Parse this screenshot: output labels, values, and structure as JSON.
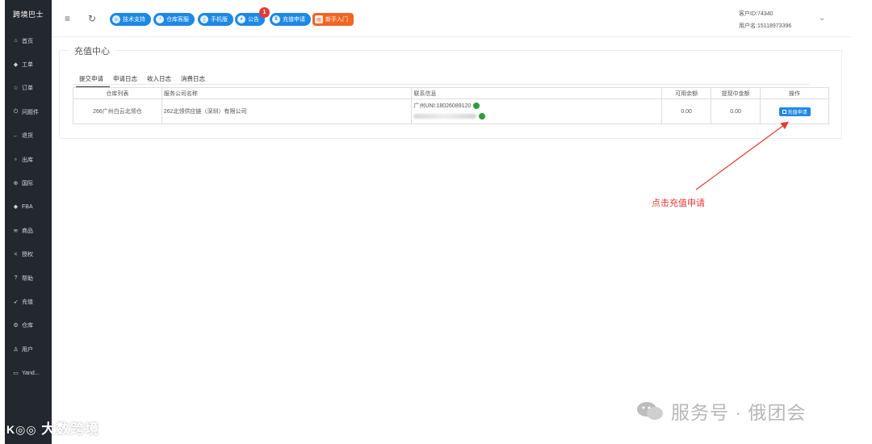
{
  "sidebar": {
    "brand": "跨境巴士",
    "items": [
      {
        "label": "首页",
        "icon": "home-icon",
        "glyph": "⌂"
      },
      {
        "label": "工单",
        "icon": "diamond-icon",
        "glyph": "◆"
      },
      {
        "label": "订单",
        "icon": "star-icon",
        "glyph": "☆"
      },
      {
        "label": "问题件",
        "icon": "power-icon",
        "glyph": "⏻"
      },
      {
        "label": "退货",
        "icon": "arrow-left-icon",
        "glyph": "←"
      },
      {
        "label": "出库",
        "icon": "thumb-icon",
        "glyph": "♁"
      },
      {
        "label": "国际",
        "icon": "globe-icon",
        "glyph": "⊕"
      },
      {
        "label": "FBA",
        "icon": "diamond-icon",
        "glyph": "◆"
      },
      {
        "label": "商品",
        "icon": "stack-icon",
        "glyph": "≋"
      },
      {
        "label": "授权",
        "icon": "share-icon",
        "glyph": "<"
      },
      {
        "label": "帮助",
        "icon": "question-icon",
        "glyph": "?"
      },
      {
        "label": "充值",
        "icon": "send-icon",
        "glyph": "➶"
      },
      {
        "label": "仓库",
        "icon": "gear-icon",
        "glyph": "⚙"
      },
      {
        "label": "用户",
        "icon": "users-icon",
        "glyph": "♙"
      },
      {
        "label": "Yand...",
        "icon": "card-icon",
        "glyph": "▭"
      }
    ]
  },
  "topbar": {
    "menu_icon": "menu-icon",
    "refresh_icon": "refresh-icon",
    "pills": [
      {
        "label": "技术支持",
        "icon": "headset-icon",
        "glyph": "☏"
      },
      {
        "label": "仓库客服",
        "icon": "headphones-icon",
        "glyph": "◔"
      },
      {
        "label": "手机版",
        "icon": "phone-icon",
        "glyph": "▯"
      },
      {
        "label": "公告",
        "icon": "megaphone-icon",
        "glyph": "◕"
      },
      {
        "label": "充值申请",
        "icon": "money-icon",
        "glyph": "¥"
      },
      {
        "label": "新手入门",
        "icon": "book-icon",
        "glyph": "▤"
      }
    ],
    "notice_badge": "1",
    "customer_id": "客户ID:74340",
    "username": "用户名:15118973396"
  },
  "panel": {
    "title": "充值中心",
    "tabs": [
      "提交申请",
      "申请日志",
      "收入日志",
      "消费日志"
    ],
    "columns": [
      "仓库列表",
      "服务公司名称",
      "联系信息",
      "可用余额",
      "提现中金额",
      "操作"
    ],
    "rows": [
      {
        "warehouse": "266广州白云北领仓",
        "company": "262北领供应链（深圳）有限公司",
        "contact": "广州UNI:18026089120",
        "available": "0.00",
        "withdrawing": "0.00",
        "action": "充值申请"
      }
    ]
  },
  "annotation": {
    "text": "点击充值申请",
    "color": "#e53935"
  },
  "watermarks": {
    "left": "大数跨境",
    "right": "服务号 · 俄团会"
  },
  "colors": {
    "sidebar_bg": "#23272e",
    "accent_blue": "#1e88e5",
    "accent_orange": "#f26522",
    "badge_red": "#e53935",
    "wechat_green": "#2e9d3f"
  }
}
